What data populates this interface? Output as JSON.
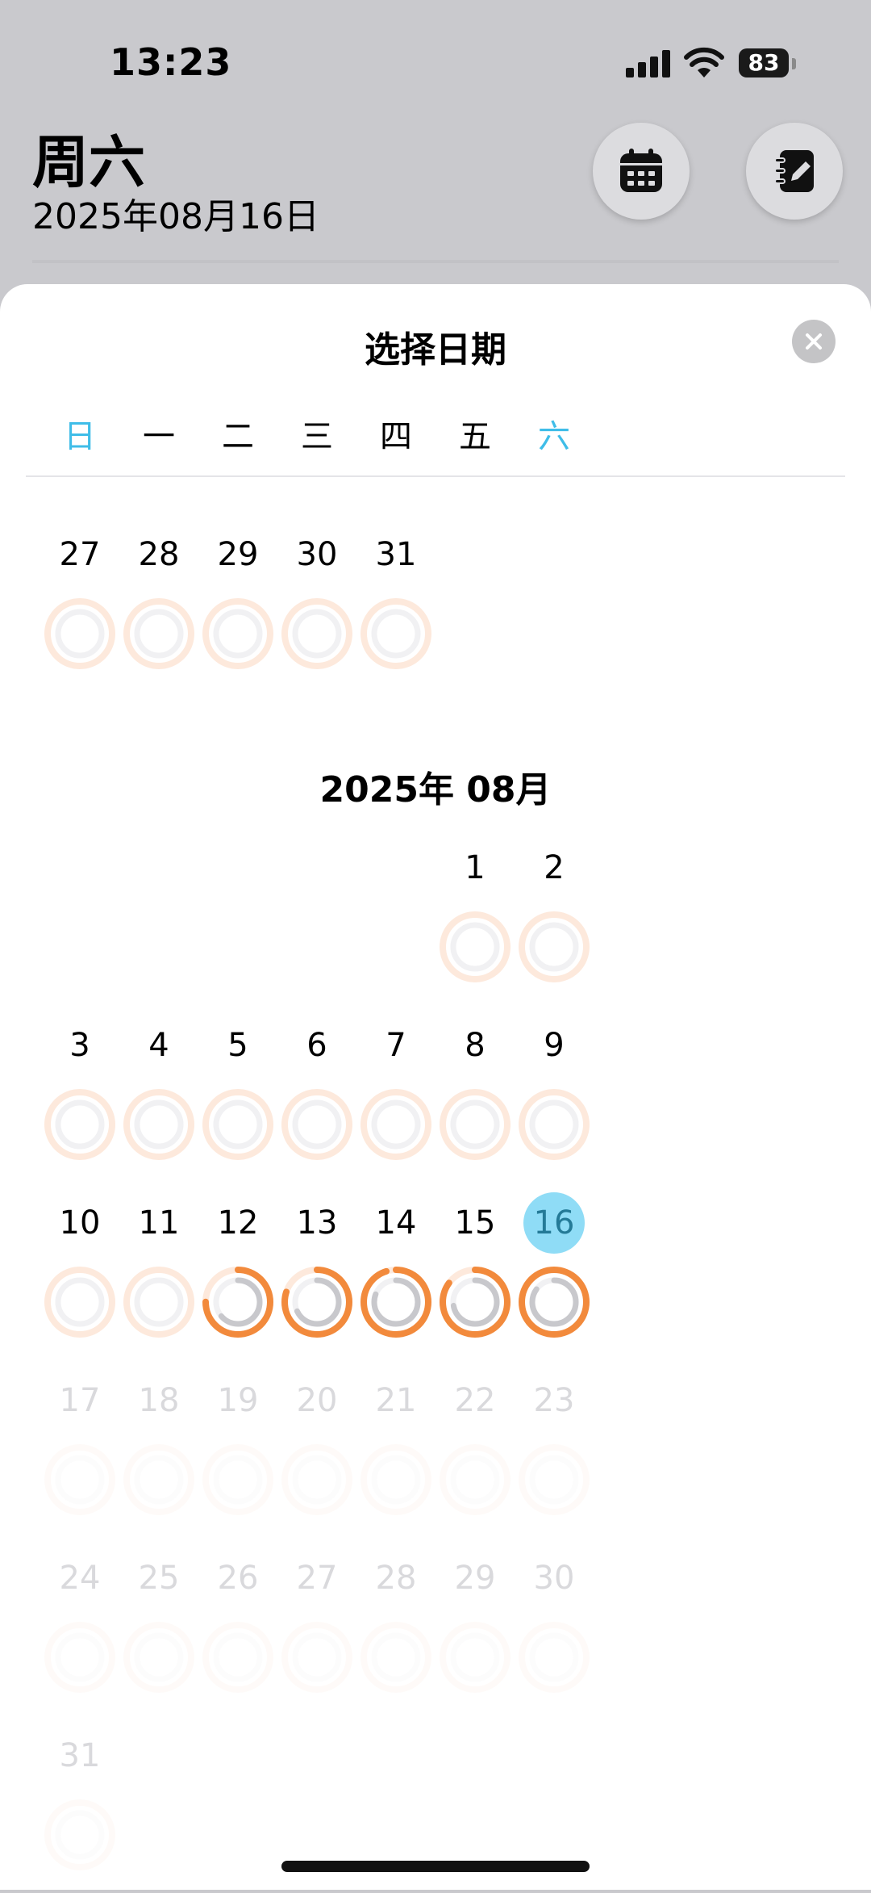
{
  "status_bar": {
    "time": "13:23",
    "battery": "83"
  },
  "header": {
    "day": "周六",
    "date": "2025年08月16日"
  },
  "sheet": {
    "title": "选择日期"
  },
  "weekdays": [
    "日",
    "一",
    "二",
    "三",
    "四",
    "五",
    "六"
  ],
  "colors": {
    "weekend": "#3fbde8",
    "ring_track": "#fde9dc",
    "ring_fill": "#f28a3c",
    "selected_bg": "#8fdcf6"
  },
  "prev_month": {
    "days": [
      {
        "d": "27",
        "col": 0,
        "progress": 0
      },
      {
        "d": "28",
        "col": 1,
        "progress": 0
      },
      {
        "d": "29",
        "col": 2,
        "progress": 0
      },
      {
        "d": "30",
        "col": 3,
        "progress": 0
      },
      {
        "d": "31",
        "col": 4,
        "progress": 0
      }
    ]
  },
  "month": {
    "title": "2025年 08月",
    "days": [
      {
        "d": "1",
        "progress": 0
      },
      {
        "d": "2",
        "progress": 0
      },
      {
        "d": "3",
        "progress": 0
      },
      {
        "d": "4",
        "progress": 0
      },
      {
        "d": "5",
        "progress": 0
      },
      {
        "d": "6",
        "progress": 0
      },
      {
        "d": "7",
        "progress": 0
      },
      {
        "d": "8",
        "progress": 0
      },
      {
        "d": "9",
        "progress": 0
      },
      {
        "d": "10",
        "progress": 0
      },
      {
        "d": "11",
        "progress": 0
      },
      {
        "d": "12",
        "progress": 0.75
      },
      {
        "d": "13",
        "progress": 0.8
      },
      {
        "d": "14",
        "progress": 0.95
      },
      {
        "d": "15",
        "progress": 0.85
      },
      {
        "d": "16",
        "progress": 1.0,
        "selected": true
      },
      {
        "d": "17",
        "future": true
      },
      {
        "d": "18",
        "future": true
      },
      {
        "d": "19",
        "future": true
      },
      {
        "d": "20",
        "future": true
      },
      {
        "d": "21",
        "future": true
      },
      {
        "d": "22",
        "future": true
      },
      {
        "d": "23",
        "future": true
      },
      {
        "d": "24",
        "future": true
      },
      {
        "d": "25",
        "future": true
      },
      {
        "d": "26",
        "future": true
      },
      {
        "d": "27",
        "future": true
      },
      {
        "d": "28",
        "future": true
      },
      {
        "d": "29",
        "future": true
      },
      {
        "d": "30",
        "future": true
      },
      {
        "d": "31",
        "future": true
      }
    ]
  }
}
